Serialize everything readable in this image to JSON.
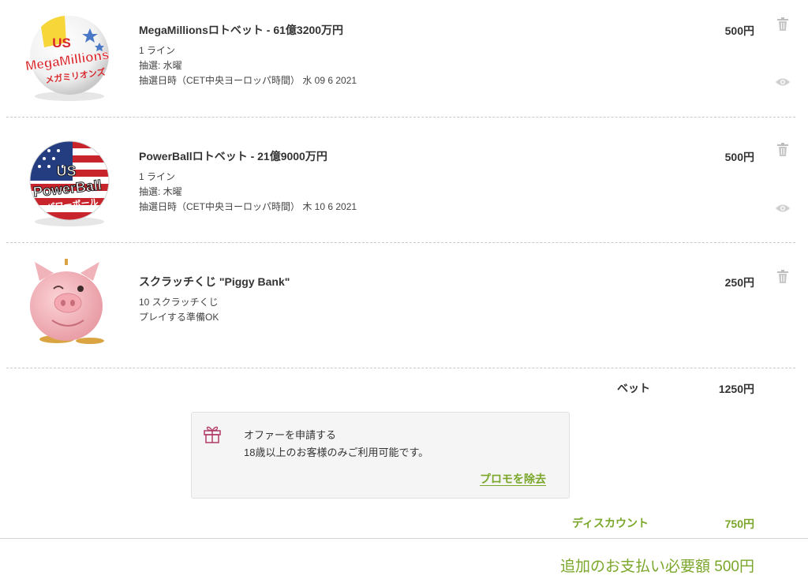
{
  "colors": {
    "accent": "#7aa62a",
    "text": "#333333",
    "gift": "#b23a66"
  },
  "items": [
    {
      "title": "MegaMillionsロトベット - 61億3200万円",
      "price": "500円",
      "meta": [
        "1 ライン",
        "抽選: 水曜",
        "抽選日時（CET中央ヨーロッパ時間） 水 09 6 2021"
      ],
      "logo": {
        "top": "US",
        "main": "MegaMillions",
        "sub": "メガミリオンズ"
      }
    },
    {
      "title": "PowerBallロトベット - 21億9000万円",
      "price": "500円",
      "meta": [
        "1 ライン",
        "抽選: 木曜",
        "抽選日時（CET中央ヨーロッパ時間） 木 10 6 2021"
      ],
      "logo": {
        "top": "US",
        "main": "PowerBall",
        "sub": "パワーボール"
      }
    },
    {
      "title": "スクラッチくじ \"Piggy Bank\"",
      "price": "250円",
      "meta": [
        "10 スクラッチくじ",
        "プレイする準備OK"
      ]
    }
  ],
  "summary": {
    "bet_label": "ベット",
    "bet_value": "1250円",
    "discount_label": "ディスカウント",
    "discount_value": "750円",
    "total_text": "追加のお支払い必要額 500円"
  },
  "offer": {
    "title": "オファーを申請する",
    "subtitle": "18歳以上のお客様のみご利用可能です。",
    "link": "プロモを除去"
  }
}
